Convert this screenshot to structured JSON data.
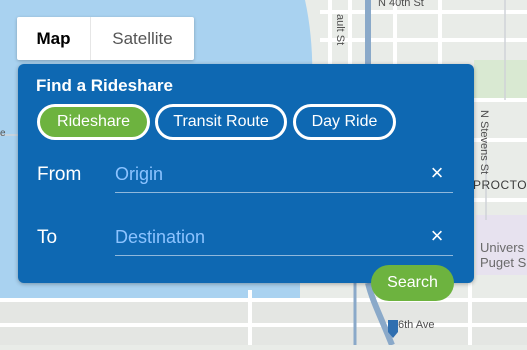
{
  "map": {
    "street_labels": {
      "north_40th": "N 40th St",
      "ault": "ault St",
      "stevens": "N Stevens St",
      "procto": "PROCTO",
      "univ_line1": "Univers",
      "univ_line2": "Puget S",
      "sixth_ave": "6th Ave",
      "edge": "e"
    },
    "colors": {
      "land": "#e9ece8",
      "water": "#a9d2f0",
      "road": "#ffffff",
      "park": "#cfe5c8"
    }
  },
  "map_toggle": {
    "map_label": "Map",
    "satellite_label": "Satellite",
    "selected": "Map"
  },
  "panel": {
    "title": "Find a Rideshare",
    "chips": [
      {
        "label": "Rideshare",
        "selected": true
      },
      {
        "label": "Transit Route",
        "selected": false
      },
      {
        "label": "Day Ride",
        "selected": false
      }
    ],
    "from": {
      "label": "From",
      "value": "",
      "placeholder": "Origin",
      "clear_icon": "×"
    },
    "to": {
      "label": "To",
      "value": "",
      "placeholder": "Destination",
      "clear_icon": "×"
    },
    "search_label": "Search",
    "colors": {
      "panel_bg": "#0e68b2",
      "accent_green": "#6db33f",
      "placeholder": "#8cc3ff"
    }
  }
}
